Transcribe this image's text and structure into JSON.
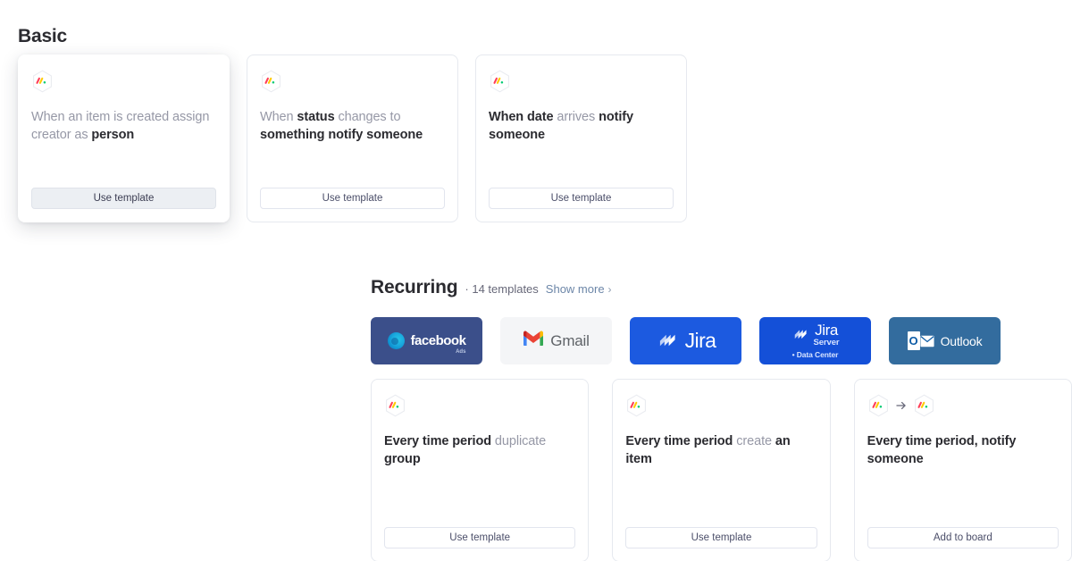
{
  "basic": {
    "title": "Basic",
    "cards": [
      {
        "icons": [
          "monday-hex-icon"
        ],
        "segments": [
          {
            "text": "When an item is created assign creator as ",
            "bold": false
          },
          {
            "text": "person",
            "bold": true
          }
        ],
        "button_label": "Use template",
        "button_style": "filled",
        "hovered": true
      },
      {
        "icons": [
          "monday-hex-icon"
        ],
        "segments": [
          {
            "text": "When ",
            "bold": false
          },
          {
            "text": "status",
            "bold": true
          },
          {
            "text": " changes to ",
            "bold": false
          },
          {
            "text": "something notify someone",
            "bold": true
          }
        ],
        "button_label": "Use template",
        "button_style": "outline",
        "hovered": false
      },
      {
        "icons": [
          "monday-hex-icon"
        ],
        "segments": [
          {
            "text": "When date",
            "bold": true
          },
          {
            "text": " arrives ",
            "bold": false
          },
          {
            "text": "notify someone",
            "bold": true
          }
        ],
        "button_label": "Use template",
        "button_style": "outline",
        "hovered": false
      }
    ]
  },
  "recurring": {
    "title": "Recurring",
    "separator": "·",
    "templates_count_label": "14 templates",
    "show_more_label": "Show more",
    "show_more_chevron": "›",
    "tiles": [
      {
        "name": "facebook-ads",
        "label": "facebook",
        "sub_label": "Ads",
        "bg": "#3b4f8a",
        "kind": "facebook"
      },
      {
        "name": "gmail",
        "label": "Gmail",
        "bg": "#f4f5f7",
        "kind": "gmail"
      },
      {
        "name": "jira",
        "label": "Jira",
        "bg": "#1c5ae0",
        "kind": "jira"
      },
      {
        "name": "jira-server-data-center",
        "label": "Jira",
        "sub_label": "Server",
        "sub_label2": "• Data Center",
        "bg": "#1450d8",
        "kind": "jira-sd"
      },
      {
        "name": "outlook",
        "label": "Outlook",
        "o_letter": "O",
        "bg": "#336c9e",
        "kind": "outlook"
      }
    ],
    "cards": [
      {
        "icons": [
          "monday-hex-icon"
        ],
        "segments": [
          {
            "text": "Every time period",
            "bold": true
          },
          {
            "text": " duplicate ",
            "bold": false
          },
          {
            "text": "group",
            "bold": true
          }
        ],
        "button_label": "Use template",
        "button_style": "outline",
        "hovered": false
      },
      {
        "icons": [
          "monday-hex-icon"
        ],
        "segments": [
          {
            "text": "Every time period",
            "bold": true
          },
          {
            "text": " create ",
            "bold": false
          },
          {
            "text": "an item",
            "bold": true
          }
        ],
        "button_label": "Use template",
        "button_style": "outline",
        "hovered": false
      },
      {
        "icons": [
          "monday-hex-icon",
          "arrow-right-icon",
          "monday-hex-icon"
        ],
        "segments": [
          {
            "text": "Every time period, notify someone",
            "bold": true
          }
        ],
        "button_label": "Add to board",
        "button_style": "outline",
        "hovered": false
      }
    ]
  },
  "colors": {
    "text_primary": "#2b2b30",
    "text_muted": "#9698a6",
    "link": "#6c86a8",
    "card_border": "#e6e9ef",
    "button_filled_bg": "#eceff3"
  }
}
